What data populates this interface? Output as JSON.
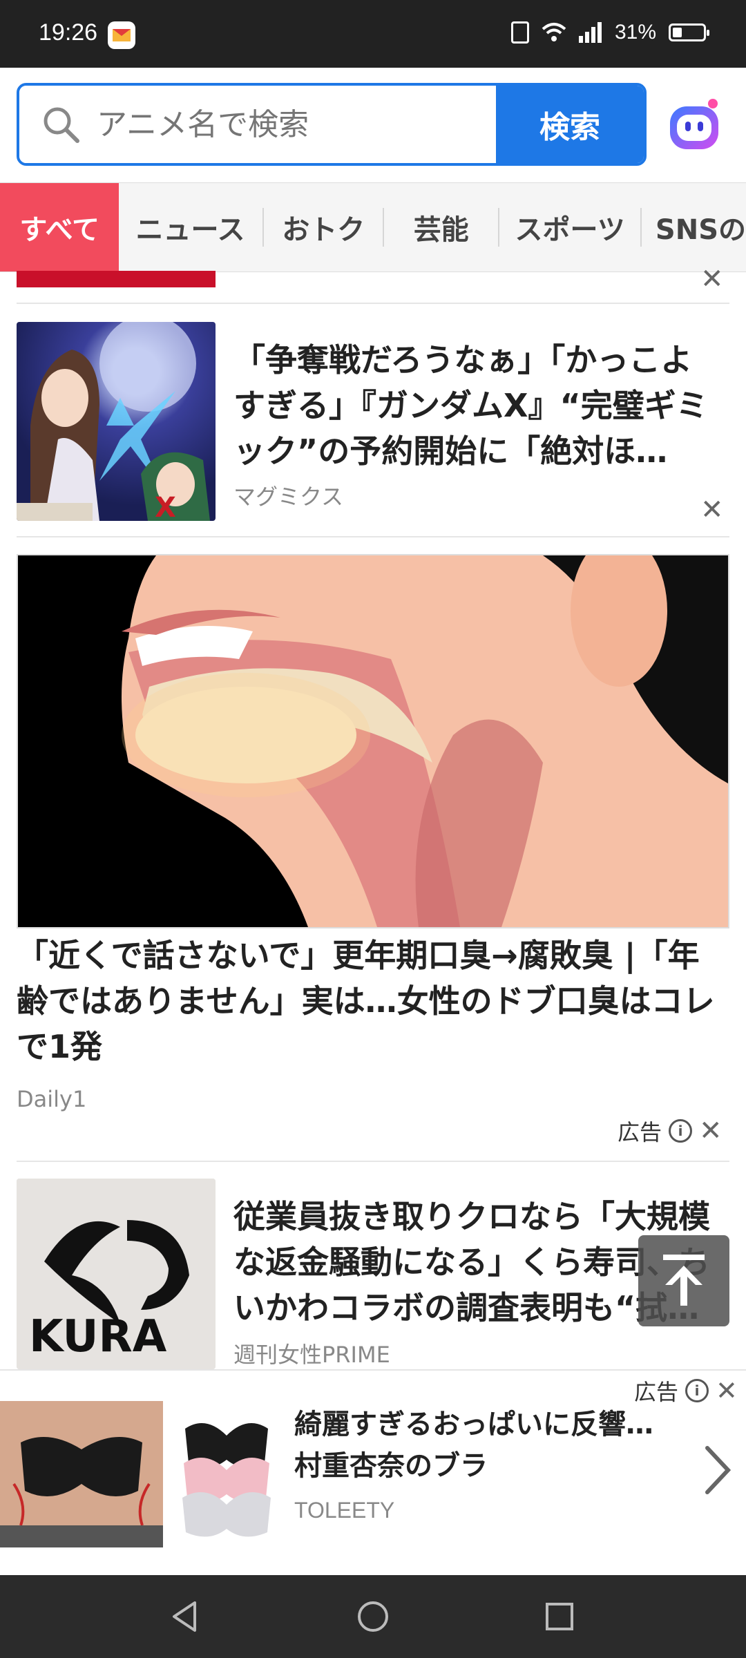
{
  "status_bar": {
    "time": "19:26",
    "battery": "31%",
    "battery_level": 0.31
  },
  "search": {
    "placeholder": "アニメ名で検索",
    "button_label": "検索"
  },
  "tabs": [
    "すべて",
    "ニュース",
    "おトク",
    "芸能",
    "スポーツ",
    "SNSの"
  ],
  "articles": [
    {
      "title": "「争奪戦だろうなぁ」「かっこよすぎる」『ガンダムX』“完璧ギミック”の予約開始に「絶対ほ…",
      "source": "マグミクス"
    },
    {
      "title": "「近くで話さないで」更年期口臭→腐敗臭 |「年齢ではありません」実は…女性のドブ口臭はコレで1発",
      "source": "Daily1",
      "ad_label": "広告"
    },
    {
      "title": "従業員抜き取りクロなら「大規模な返金騒動になる」くら寿司、ちいかわコラボの調査表明も“拭…",
      "source": "週刊女性PRIME"
    }
  ],
  "bottom_ad": {
    "ad_label": "広告",
    "title": "綺麗すぎるおっぱいに反響…村重杏奈のブラ",
    "brand": "TOLEETY"
  },
  "icons": {
    "search": "search-icon",
    "bot": "bot-icon",
    "close": "close-icon",
    "info": "info-icon",
    "scroll_top": "arrow-up-icon",
    "chevron": "chevron-right-icon"
  },
  "colors": {
    "accent": "#1e78e6",
    "active_tab": "#f24b5d"
  }
}
